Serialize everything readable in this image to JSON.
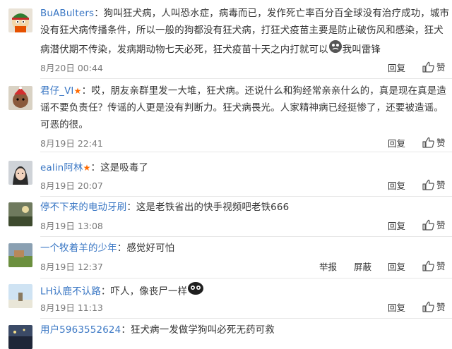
{
  "actions": {
    "reply": "回复",
    "like": "赞",
    "report": "举报",
    "block": "屏蔽"
  },
  "comments": [
    {
      "user": "BuABulters",
      "text": "：狗叫狂犬病，人叫恐水症，病毒而已，发作死亡率百分百全球没有治疗成功，城市没有狂犬病传播条件，所以一般的狗都没有狂犬病，打狂犬疫苗主要是防止破伤风和感染，狂犬病潜伏期不传染，发病期动物七天必死，狂犬疫苗十天之内打就可以",
      "text_after_emoji": "我叫雷锋",
      "time": "8月20日 00:44"
    },
    {
      "user": "君仔_VI",
      "badge": "★",
      "text": "：哎，朋友亲群里发一大堆，狂犬病。还说什么和狗经常亲亲什么的，真是现在真是造谣不要负责任？传谣的人更是没有判断力。狂犬病畏光。人家精神病已经挺惨了，还要被造谣。可恶的很。",
      "time": "8月19日 22:41"
    },
    {
      "user": "ealin阿林",
      "badge": "★",
      "text": "：这是吸毒了",
      "time": "8月19日 20:07"
    },
    {
      "user": "停不下来的电动牙刷",
      "text": "：这是老铁省出的快手视频吧老铁666",
      "time": "8月19日 13:08"
    },
    {
      "user": "一个牧着羊的少年",
      "text": "：感觉好可怕",
      "time": "8月19日 12:37"
    },
    {
      "user": "LH认鹿不认路",
      "text": "：吓人，像丧尸一样",
      "time": "8月19日 11:13"
    },
    {
      "user": "用户5963552624",
      "text": "：狂犬病一发做学狗叫必死无药可救"
    }
  ]
}
